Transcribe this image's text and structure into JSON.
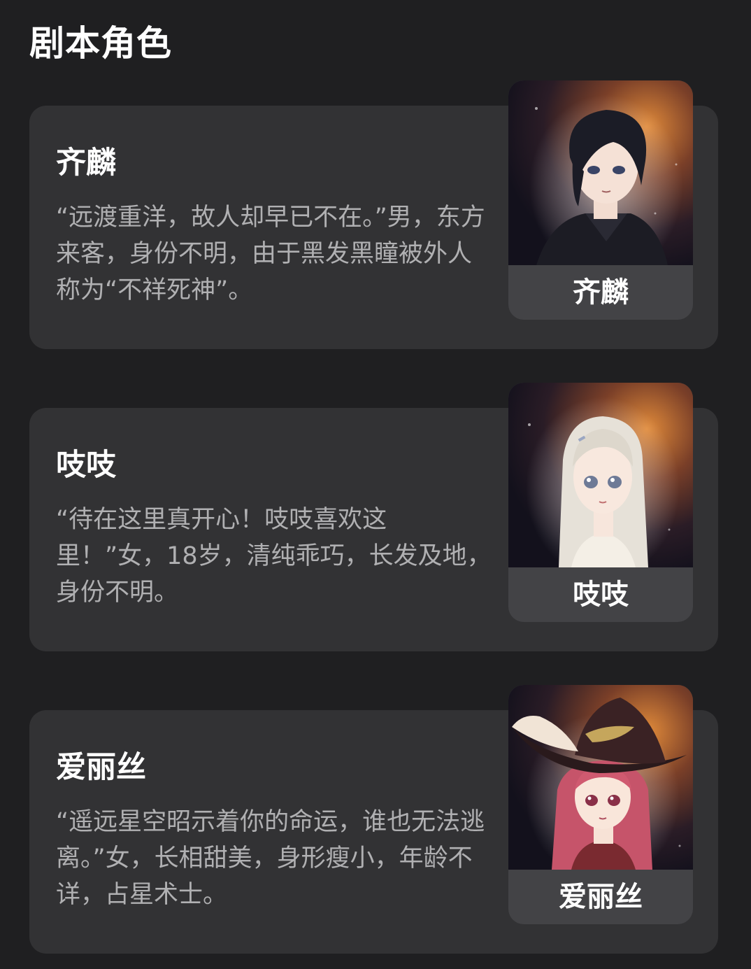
{
  "section": {
    "title": "剧本角色"
  },
  "characters": [
    {
      "name": "齐麟",
      "description": "“远渡重洋，故人却早已不在。”男，东方来客，身份不明，由于黑发黑瞳被外人称为“不祥死神”。",
      "portrait_label": "齐麟",
      "portrait_icon": "dark-haired-man-portrait"
    },
    {
      "name": "吱吱",
      "description": "“待在这里真开心！吱吱喜欢这里！”女，18岁，清纯乖巧，长发及地，身份不明。",
      "portrait_label": "吱吱",
      "portrait_icon": "silver-haired-girl-portrait"
    },
    {
      "name": "爱丽丝",
      "description": "“遥远星空昭示着你的命运，谁也无法逃离。”女，长相甜美，身形瘦小，年龄不详，占星术士。",
      "portrait_label": "爱丽丝",
      "portrait_icon": "witch-hat-girl-portrait"
    }
  ],
  "colors": {
    "background": "#1f1f21",
    "card": "#323234",
    "portrait_label_bg": "#434346",
    "description_text": "#b0b0b2"
  }
}
